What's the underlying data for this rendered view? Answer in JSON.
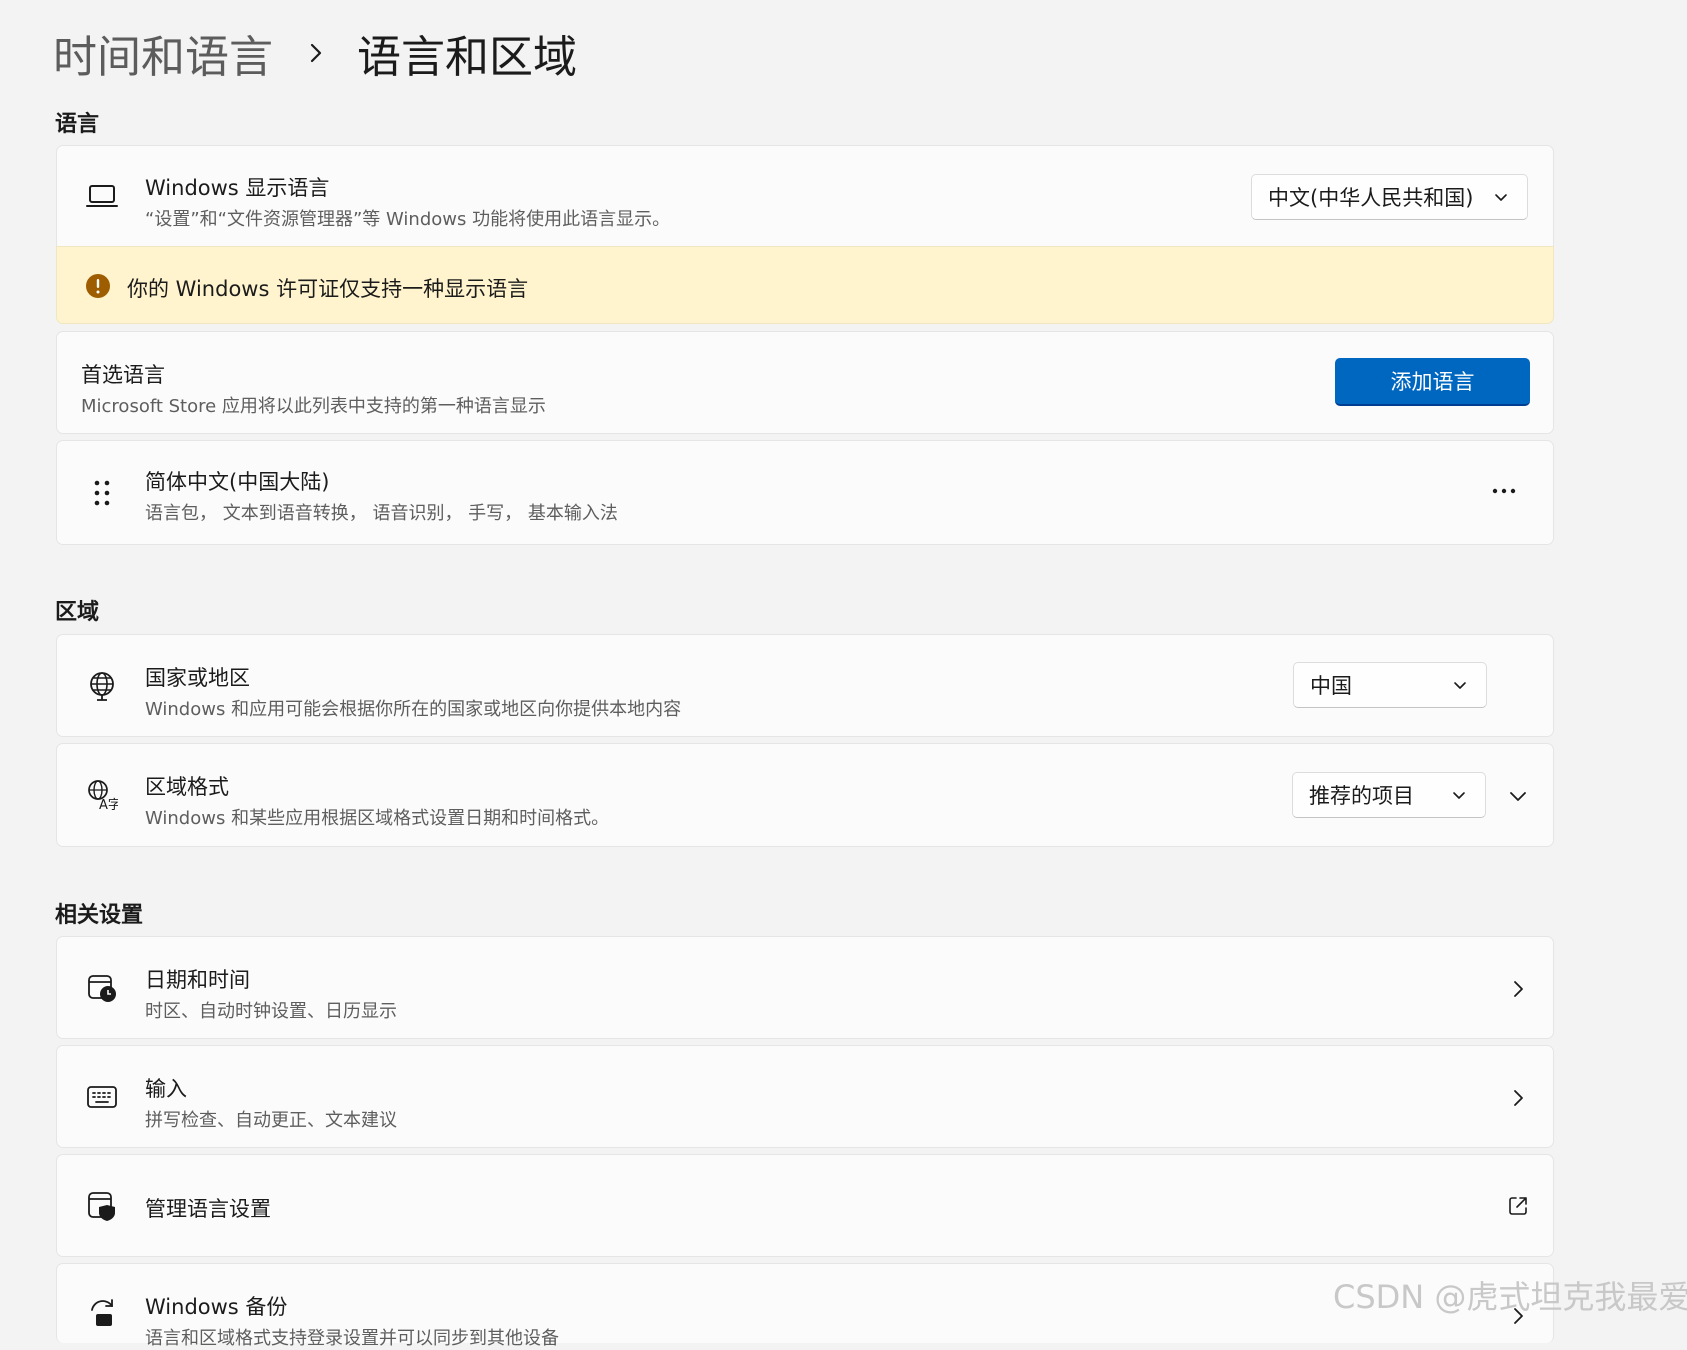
{
  "breadcrumb": {
    "parent": "时间和语言",
    "current": "语言和区域"
  },
  "sections": {
    "language": "语言",
    "region": "区域",
    "related": "相关设置"
  },
  "display_language": {
    "title": "Windows 显示语言",
    "description": "“设置”和“文件资源管理器”等 Windows 功能将使用此语言显示。",
    "value": "中文(中华人民共和国)",
    "icon": "laptop-icon"
  },
  "warning": {
    "text": "你的 Windows 许可证仅支持一种显示语言",
    "icon": "warning-icon",
    "color": "#9d5d00"
  },
  "preferred": {
    "title": "首选语言",
    "description": "Microsoft Store 应用将以此列表中支持的第一种语言显示",
    "button": "添加语言",
    "accent": "#0067c0"
  },
  "language_item": {
    "title": "简体中文(中国大陆)",
    "description": "语言包， 文本到语音转换， 语音识别， 手写， 基本输入法",
    "icon": "drag-handle-icon"
  },
  "country": {
    "title": "国家或地区",
    "description": "Windows 和应用可能会根据你所在的国家或地区向你提供本地内容",
    "value": "中国",
    "icon": "globe-icon"
  },
  "regional_format": {
    "title": "区域格式",
    "description": "Windows 和某些应用根据区域格式设置日期和时间格式。",
    "value": "推荐的项目",
    "icon": "globe-text-icon"
  },
  "related": {
    "date_time": {
      "title": "日期和时间",
      "description": "时区、自动时钟设置、日历显示",
      "icon": "calendar-clock-icon"
    },
    "typing": {
      "title": "输入",
      "description": "拼写检查、自动更正、文本建议",
      "icon": "keyboard-icon"
    },
    "admin": {
      "title": "管理语言设置",
      "icon": "shield-window-icon"
    },
    "backup": {
      "title": "Windows 备份",
      "description": "语言和区域格式支持登录设置并可以同步到其他设备",
      "icon": "sync-icon"
    }
  },
  "watermark": "CSDN @虎式坦克我最爱"
}
